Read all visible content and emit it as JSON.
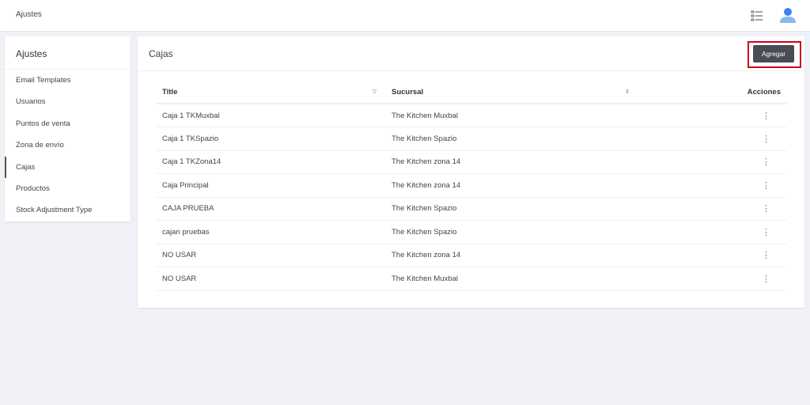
{
  "topbar": {
    "title": "Ajustes"
  },
  "sidebar": {
    "title": "Ajustes",
    "items": [
      {
        "label": "Email Templates"
      },
      {
        "label": "Usuarios"
      },
      {
        "label": "Puntos de venta"
      },
      {
        "label": "Zona de envío"
      },
      {
        "label": "Cajas"
      },
      {
        "label": "Productos"
      },
      {
        "label": "Stock Adjustment Type"
      }
    ],
    "active": "Cajas"
  },
  "main": {
    "title": "Cajas",
    "add_label": "Agregar",
    "columns": [
      "Title",
      "Sucursal",
      "Acciones"
    ],
    "rows": [
      {
        "title": "Caja 1 TKMuxbal",
        "sucursal": "The Kitchen Muxbal"
      },
      {
        "title": "Caja 1 TKSpazio",
        "sucursal": "The Kitchen Spazio"
      },
      {
        "title": "Caja 1 TKZona14",
        "sucursal": "The Kitchen zona 14"
      },
      {
        "title": "Caja Principal",
        "sucursal": "The Kitchen zona 14"
      },
      {
        "title": "CAJA PRUEBA",
        "sucursal": "The Kitchen Spazio"
      },
      {
        "title": "cajan pruebas",
        "sucursal": "The Kitchen Spazio"
      },
      {
        "title": "NO USAR",
        "sucursal": "The Kitchen zona 14"
      },
      {
        "title": "NO USAR",
        "sucursal": "The Kitchen Muxbal"
      }
    ]
  },
  "colors": {
    "accent": "#4a4c55",
    "highlight": "#d0021b",
    "avatar": "#4a90e2"
  }
}
